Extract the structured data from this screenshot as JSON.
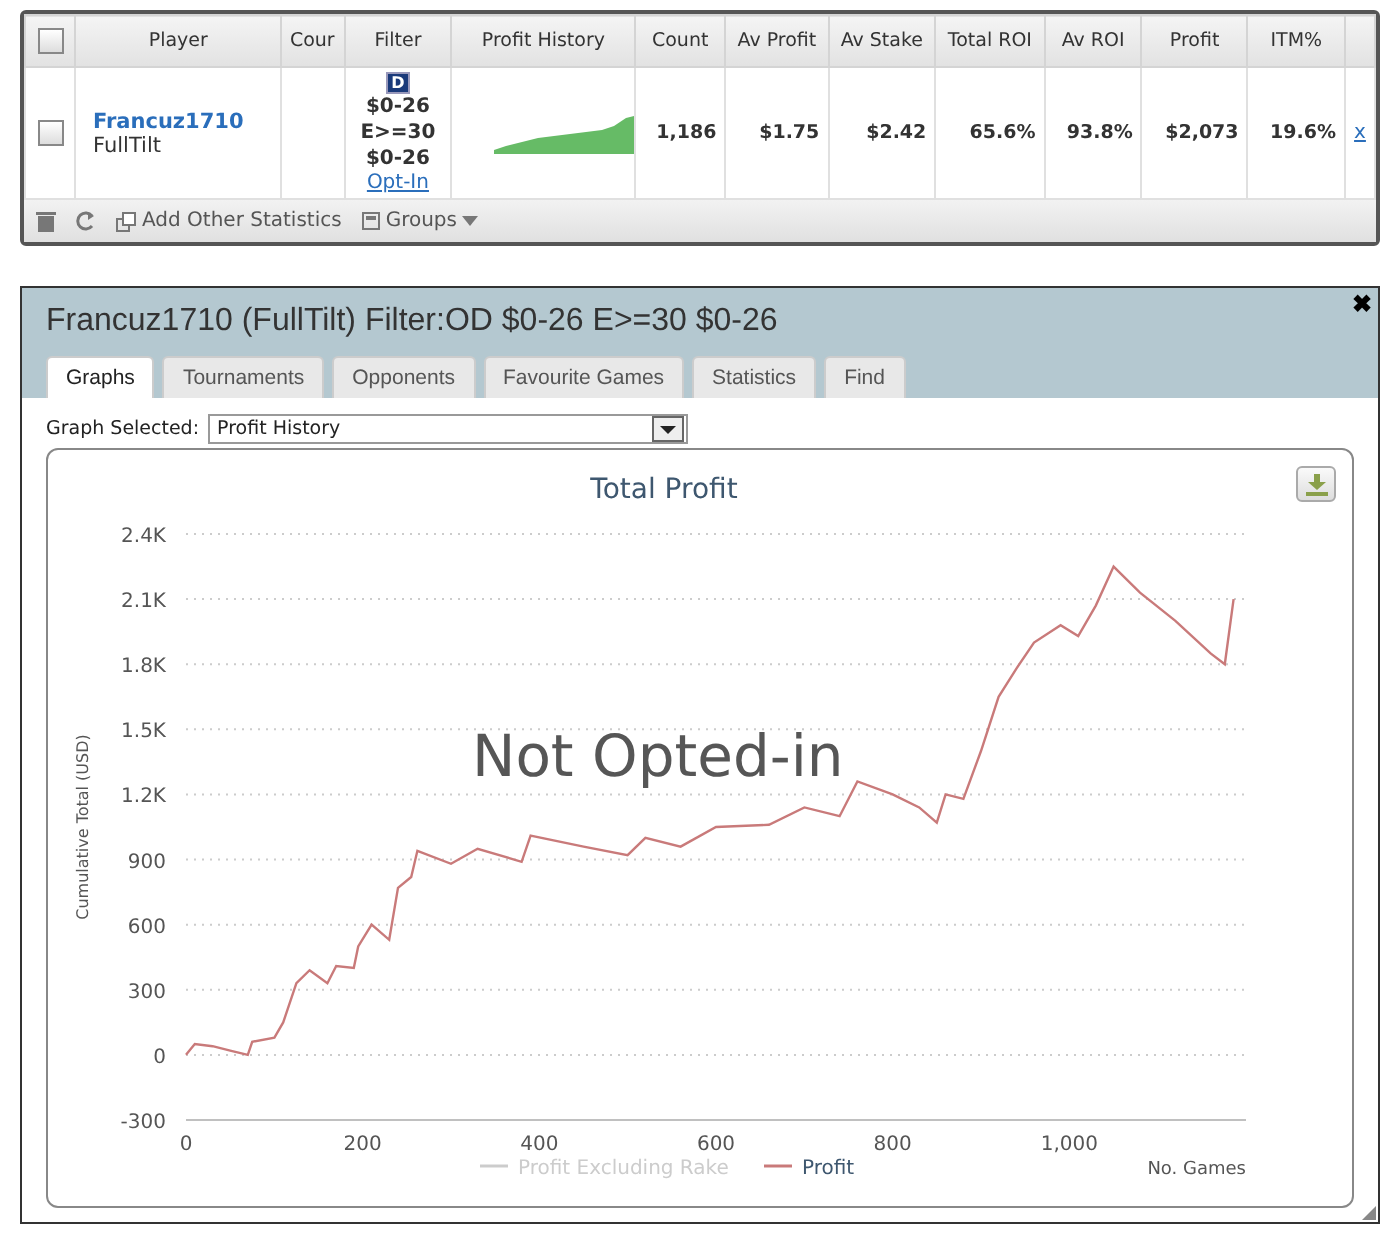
{
  "grid": {
    "columns": [
      {
        "kind": "check",
        "checked": false
      },
      {
        "kind": "text",
        "label": "Player"
      },
      {
        "kind": "text",
        "label": "Cour"
      },
      {
        "kind": "text",
        "label": "Filter"
      },
      {
        "kind": "text",
        "label": "Profit History"
      },
      {
        "kind": "text",
        "label": "Count"
      },
      {
        "kind": "text",
        "label": "Av Profit"
      },
      {
        "kind": "text",
        "label": "Av Stake"
      },
      {
        "kind": "text",
        "label": "Total ROI"
      },
      {
        "kind": "text",
        "label": "Av ROI"
      },
      {
        "kind": "text",
        "label": "Profit"
      },
      {
        "kind": "text",
        "label": "ITM%"
      },
      {
        "kind": "blank"
      }
    ],
    "rows": [
      {
        "checked": false,
        "player": "Francuz1710",
        "network": "FullTilt",
        "filter": {
          "badge": "D",
          "lines": [
            "$0-26",
            "E>=30",
            "$0-26"
          ],
          "link": "Opt-In"
        },
        "stats": [
          "1,186",
          "$1.75",
          "$2.42",
          "65.6%",
          "93.8%",
          "$2,073",
          "19.6%"
        ],
        "remove": "x"
      }
    ],
    "footer": {
      "add_stats": "Add Other Statistics",
      "groups": "Groups"
    }
  },
  "dialog": {
    "title": "Francuz1710 (FullTilt) Filter:OD $0-26 E>=30 $0-26",
    "tabs": [
      {
        "label": "Graphs",
        "selected": true
      },
      {
        "label": "Tournaments",
        "selected": false
      },
      {
        "label": "Opponents",
        "selected": false
      },
      {
        "label": "Favourite Games",
        "selected": false
      },
      {
        "label": "Statistics",
        "selected": false
      },
      {
        "label": "Find",
        "selected": false
      }
    ],
    "graph_select": {
      "label": "Graph Selected:",
      "value": "Profit History"
    },
    "close": "✖",
    "overlay": "Not Opted-in",
    "hidden_series": [
      {
        "name": "Profit Excluding Rake",
        "color": "#cccccc"
      }
    ],
    "chart_data": {
      "type": "line",
      "grid": true,
      "title": "Total Profit",
      "xlabel": "No. Games",
      "ylabel": "Cumulative Total (USD)",
      "xlim": [
        0,
        1200
      ],
      "ylim": [
        -300,
        2400
      ],
      "xticks": [
        0,
        200,
        400,
        600,
        800,
        {
          "value": 1000,
          "label": "1,000"
        }
      ],
      "yticks": [
        -300,
        0,
        300,
        600,
        900,
        {
          "value": 1200,
          "label": "1.2K"
        },
        {
          "value": 1500,
          "label": "1.5K"
        },
        {
          "value": 1800,
          "label": "1.8K"
        },
        {
          "value": 2100,
          "label": "2.1K"
        },
        {
          "value": 2400,
          "label": "2.4K"
        }
      ],
      "x": [
        0,
        10,
        30,
        50,
        70,
        75,
        100,
        110,
        125,
        140,
        160,
        170,
        190,
        195,
        210,
        230,
        240,
        255,
        262,
        300,
        330,
        380,
        390,
        450,
        500,
        520,
        560,
        600,
        660,
        700,
        740,
        760,
        800,
        830,
        850,
        860,
        880,
        900,
        920,
        940,
        960,
        990,
        1010,
        1030,
        1050,
        1080,
        1120,
        1160,
        1176,
        1186
      ],
      "series": [
        {
          "name": "Profit",
          "color": "#c97a7a",
          "values": [
            0,
            50,
            40,
            20,
            0,
            60,
            80,
            150,
            330,
            390,
            330,
            410,
            400,
            500,
            600,
            530,
            770,
            820,
            940,
            880,
            950,
            890,
            1010,
            960,
            920,
            1000,
            960,
            1050,
            1060,
            1140,
            1100,
            1260,
            1200,
            1140,
            1070,
            1200,
            1180,
            1400,
            1650,
            1780,
            1900,
            1980,
            1930,
            2070,
            2250,
            2130,
            2000,
            1850,
            1800,
            2100
          ]
        }
      ]
    }
  }
}
